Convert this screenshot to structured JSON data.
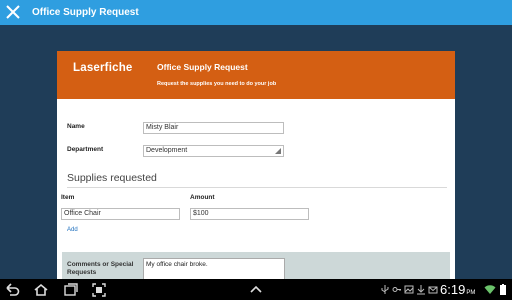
{
  "appbar": {
    "title": "Office Supply Request",
    "close_icon": "close-icon"
  },
  "form": {
    "logo": "Laserfiche",
    "title": "Office Supply Request",
    "subtitle": "Request the supplies you need to do your job",
    "name": {
      "label": "Name",
      "value": "Misty Blair"
    },
    "department": {
      "label": "Department",
      "value": "Development"
    },
    "supplies": {
      "section_title": "Supplies requested",
      "item_label": "Item",
      "amount_label": "Amount",
      "rows": [
        {
          "item": "Office Chair",
          "amount": "$100"
        }
      ],
      "add_label": "Add"
    },
    "comments": {
      "label": "Comments or Special Requests",
      "value": "My office chair broke."
    }
  },
  "statusbar": {
    "time": "6:19",
    "time_suffix": "PM"
  },
  "colors": {
    "appbar": "#2f9ee0",
    "background": "#1f3d58",
    "header": "#d45f13",
    "link": "#1c6ebd"
  }
}
